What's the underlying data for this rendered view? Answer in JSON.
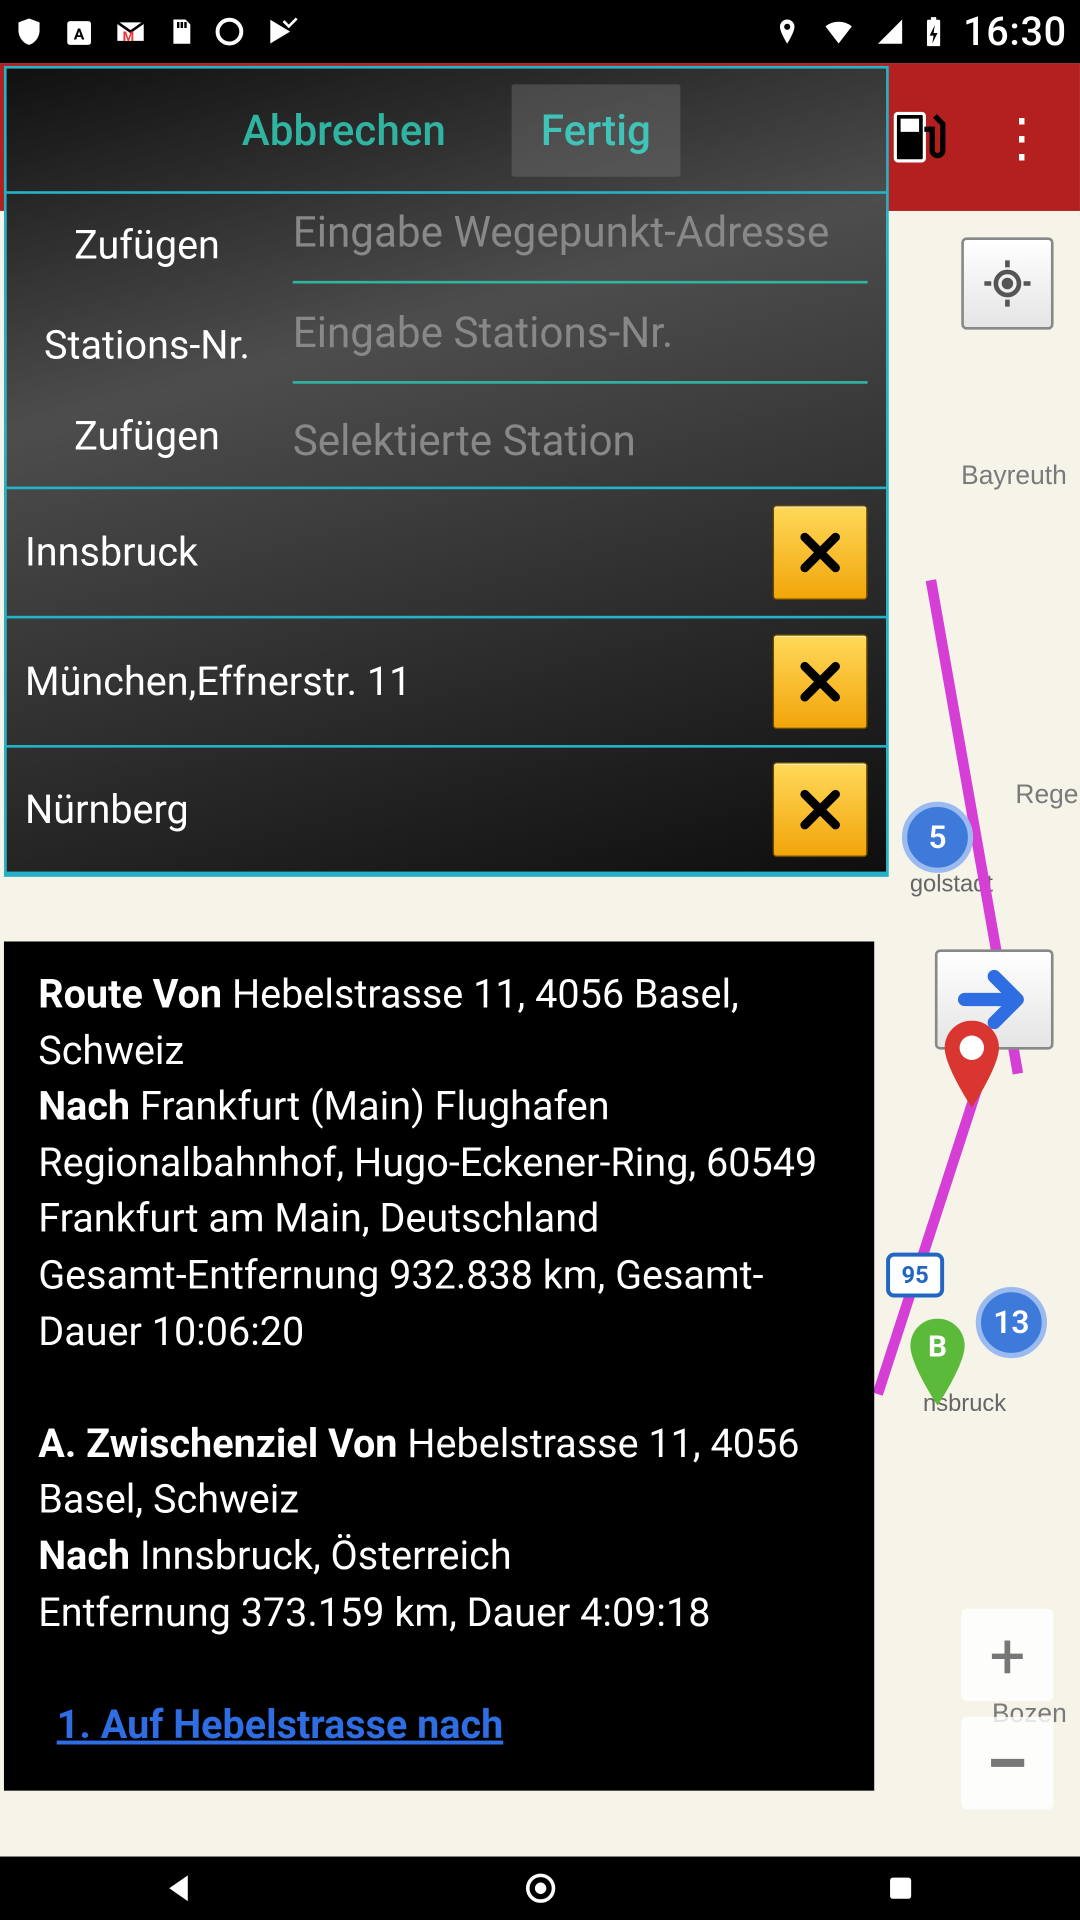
{
  "status": {
    "time": "16:30"
  },
  "dialog": {
    "cancel": "Abbrechen",
    "done": "Fertig",
    "add_waypoint_label": "Zufügen",
    "waypoint_placeholder": "Eingabe Wegepunkt-Adresse",
    "station_nr_label": "Stations-Nr.",
    "station_nr_placeholder": "Eingabe Stations-Nr.",
    "add_selected_label": "Zufügen",
    "selected_station": "Selektierte Station"
  },
  "waypoints": [
    {
      "name": "Innsbruck"
    },
    {
      "name": "München,Effnerstr. 11"
    },
    {
      "name": "Nürnberg"
    }
  ],
  "route": {
    "from_label": "Route Von",
    "from": "Hebelstrasse 11, 4056 Basel, Schweiz",
    "to_label": "Nach",
    "to": "Frankfurt (Main) Flughafen Regionalbahnhof, Hugo-Eckener-Ring, 60549 Frankfurt am Main, Deutschland",
    "total_line": "Gesamt-Entfernung 932.838 km, Gesamt-Dauer 10:06:20",
    "seg_a_hdr": "A. Zwischenziel Von",
    "seg_a_from": "Hebelstrasse 11, 4056 Basel, Schweiz",
    "seg_a_to_label": "Nach",
    "seg_a_to": "Innsbruck, Österreich",
    "seg_a_stats": "Entfernung 373.159 km, Dauer 4:09:18",
    "step1": "1. Auf Hebelstrasse nach"
  },
  "map": {
    "labels": [
      "Bayreuth",
      "Regen",
      "Bozen",
      "golstadt",
      "nsbruck"
    ],
    "cluster_values": [
      "5",
      "13"
    ],
    "shield": "95"
  }
}
